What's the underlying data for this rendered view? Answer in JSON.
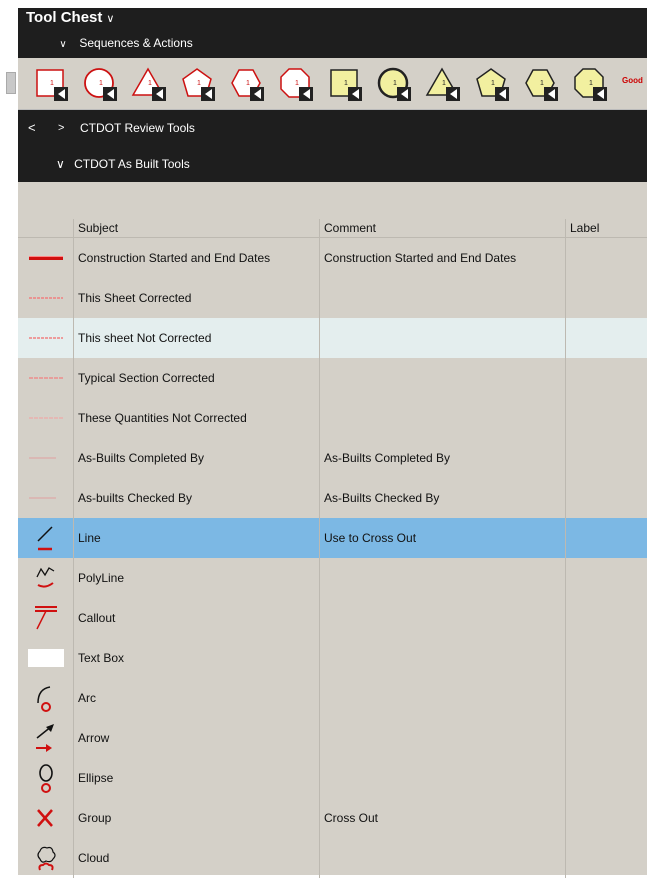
{
  "panel": {
    "title": "Tool Chest",
    "title_chevron": "∨"
  },
  "sections": {
    "sequences": {
      "label": "Sequences & Actions",
      "chevron": "∨"
    },
    "review": {
      "back": "<",
      "chevron": ">",
      "label": "CTDOT Review Tools"
    },
    "asbuilt": {
      "label": "CTDOT As Built Tools",
      "chevron": "∨"
    }
  },
  "iconbar": {
    "stamps": [
      "square-red-stamp",
      "circle-red-stamp",
      "triangle-red-stamp",
      "pentagon-red-stamp",
      "hexagon-red-stamp",
      "octagon-red-stamp",
      "square-yellow-stamp",
      "circle-yellow-stamp",
      "triangle-yellow-stamp",
      "pentagon-yellow-stamp",
      "hexagon-yellow-stamp",
      "octagon-yellow-stamp"
    ],
    "stamp_number": "1",
    "overflow_text": "Good",
    "colors": {
      "red": "#cc1111",
      "yellow": "#f2f0a0"
    }
  },
  "table": {
    "columns": [
      "Subject",
      "Comment",
      "Label"
    ],
    "rows": [
      {
        "icon": "date-stamp-icon",
        "subject": "Construction Started and End Dates",
        "comment": "Construction Started and End Dates",
        "label": ""
      },
      {
        "icon": "sheet-corrected-icon",
        "subject": "This Sheet Corrected",
        "comment": "",
        "label": ""
      },
      {
        "icon": "sheet-not-corrected-icon",
        "subject": "This sheet Not Corrected",
        "comment": "",
        "label": ""
      },
      {
        "icon": "section-corrected-icon",
        "subject": "Typical Section Corrected",
        "comment": "",
        "label": ""
      },
      {
        "icon": "quantities-not-corrected-icon",
        "subject": "These Quantities Not Corrected",
        "comment": "",
        "label": ""
      },
      {
        "icon": "completed-by-icon",
        "subject": "As-Builts Completed By",
        "comment": "As-Builts Completed By",
        "label": ""
      },
      {
        "icon": "checked-by-icon",
        "subject": "As-builts Checked By",
        "comment": "As-Builts Checked By",
        "label": ""
      },
      {
        "icon": "line-icon",
        "subject": "Line",
        "comment": "Use to Cross Out",
        "label": ""
      },
      {
        "icon": "polyline-icon",
        "subject": "PolyLine",
        "comment": "",
        "label": ""
      },
      {
        "icon": "callout-icon",
        "subject": "Callout",
        "comment": "",
        "label": ""
      },
      {
        "icon": "text-box-icon",
        "subject": "Text Box",
        "comment": "",
        "label": ""
      },
      {
        "icon": "arc-icon",
        "subject": "Arc",
        "comment": "",
        "label": ""
      },
      {
        "icon": "arrow-icon",
        "subject": "Arrow",
        "comment": "",
        "label": ""
      },
      {
        "icon": "ellipse-icon",
        "subject": "Ellipse",
        "comment": "",
        "label": ""
      },
      {
        "icon": "group-x-icon",
        "subject": "Group",
        "comment": "Cross Out",
        "label": ""
      },
      {
        "icon": "cloud-icon",
        "subject": "Cloud",
        "comment": "",
        "label": ""
      }
    ],
    "selected_row": 7,
    "alt_row": 2,
    "colors": {
      "selected": "#7cb8e4",
      "alt": "#e4eeee",
      "markup_red": "#d01010"
    }
  }
}
